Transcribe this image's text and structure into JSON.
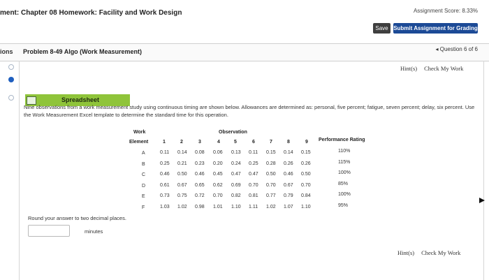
{
  "header": {
    "title": "ment: Chapter 08 Homework: Facility and Work Design",
    "assignment_score": "Assignment Score: 8.33%",
    "save_label": "Save",
    "submit_label": "Submit Assignment for Grading"
  },
  "subheader": {
    "sidebar_label": "ions",
    "problem_title": "Problem 8-49 Algo (Work Measurement)",
    "question_nav": "◂ Question 6 of 6"
  },
  "hints": {
    "hint_label": "Hint(s)",
    "check_label": "Check My Work"
  },
  "spreadsheet": {
    "label": "Spreadsheet"
  },
  "description": "Nine observations from a work measurement study using continuous timing are shown below. Allowances are determined as: personal, five percent; fatigue, seven percent; delay, six percent. Use the Work Measurement Excel template to determine the standard time for this operation.",
  "table": {
    "work_label": "Work",
    "element_label": "Element",
    "observation_label": "Observation",
    "rating_label": "Performance Rating",
    "observation_numbers": [
      "1",
      "2",
      "3",
      "4",
      "5",
      "6",
      "7",
      "8",
      "9"
    ],
    "rows": [
      {
        "element": "A",
        "values": [
          "0.11",
          "0.14",
          "0.08",
          "0.06",
          "0.13",
          "0.11",
          "0.15",
          "0.14",
          "0.15"
        ],
        "rating": "110%"
      },
      {
        "element": "B",
        "values": [
          "0.25",
          "0.21",
          "0.23",
          "0.20",
          "0.24",
          "0.25",
          "0.28",
          "0.26",
          "0.26"
        ],
        "rating": "115%"
      },
      {
        "element": "C",
        "values": [
          "0.46",
          "0.50",
          "0.46",
          "0.45",
          "0.47",
          "0.47",
          "0.50",
          "0.46",
          "0.50"
        ],
        "rating": "100%"
      },
      {
        "element": "D",
        "values": [
          "0.61",
          "0.67",
          "0.65",
          "0.62",
          "0.69",
          "0.70",
          "0.70",
          "0.67",
          "0.70"
        ],
        "rating": "85%"
      },
      {
        "element": "E",
        "values": [
          "0.73",
          "0.75",
          "0.72",
          "0.70",
          "0.82",
          "0.81",
          "0.77",
          "0.79",
          "0.84"
        ],
        "rating": "100%"
      },
      {
        "element": "F",
        "values": [
          "1.03",
          "1.02",
          "0.98",
          "1.01",
          "1.10",
          "1.11",
          "1.02",
          "1.07",
          "1.10"
        ],
        "rating": "95%"
      }
    ]
  },
  "answer": {
    "instruction": "Round your answer to two decimal places.",
    "value": "",
    "units": "minutes"
  }
}
